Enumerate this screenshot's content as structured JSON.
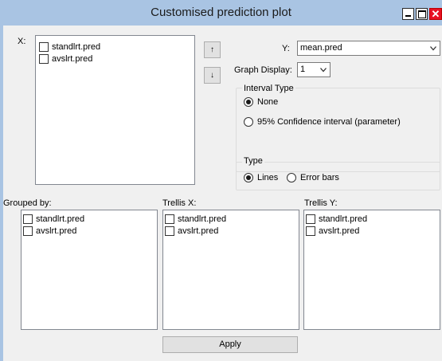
{
  "window": {
    "title": "Customised prediction plot"
  },
  "x_panel": {
    "label": "X:",
    "items": [
      "standlrt.pred",
      "avslrt.pred"
    ],
    "move_up": "↑",
    "move_down": "↓"
  },
  "y_select": {
    "label": "Y:",
    "value": "mean.pred"
  },
  "graph_display": {
    "label": "Graph Display:",
    "value": "1"
  },
  "interval_type": {
    "label": "Interval Type",
    "options": [
      "None",
      "95% Confidence interval (parameter)"
    ],
    "selected": "None"
  },
  "type_group": {
    "label": "Type",
    "options": [
      "Lines",
      "Error bars"
    ],
    "selected": "Lines"
  },
  "grouped_by": {
    "label": "Grouped by:",
    "items": [
      "standlrt.pred",
      "avslrt.pred"
    ]
  },
  "trellis_x": {
    "label": "Trellis X:",
    "items": [
      "standlrt.pred",
      "avslrt.pred"
    ]
  },
  "trellis_y": {
    "label": "Trellis Y:",
    "items": [
      "standlrt.pred",
      "avslrt.pred"
    ]
  },
  "apply_button": {
    "label": "Apply"
  }
}
